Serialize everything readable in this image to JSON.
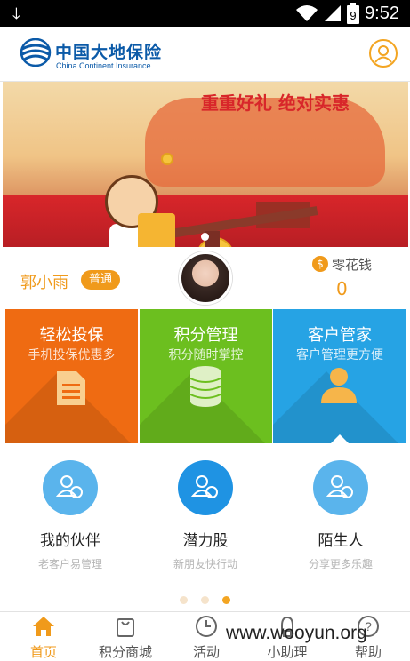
{
  "status_bar": {
    "time": "9:52",
    "battery_level": "9"
  },
  "header": {
    "brand_cn": "中国大地保险",
    "brand_en": "China Continent Insurance",
    "profile_icon": "user-circle-icon"
  },
  "banner": {
    "headline": "重重好礼 绝对实惠",
    "slide_count": 1,
    "active_slide": 1
  },
  "user": {
    "name": "郭小雨",
    "level": "普通",
    "wallet_label": "零花钱",
    "wallet_value": "0",
    "wallet_icon": "dollar-coin-icon"
  },
  "tiles": [
    {
      "title": "轻松投保",
      "subtitle": "手机投保优惠多",
      "icon": "document-icon",
      "color": "#ef6b12"
    },
    {
      "title": "积分管理",
      "subtitle": "积分随时掌控",
      "icon": "coin-stack-icon",
      "color": "#6cbf1f"
    },
    {
      "title": "客户管家",
      "subtitle": "客户管理更方便",
      "icon": "person-icon",
      "color": "#26a3e4"
    }
  ],
  "partners": [
    {
      "title": "我的伙伴",
      "subtitle": "老客户易管理",
      "icon": "partner-icon"
    },
    {
      "title": "潜力股",
      "subtitle": "新朋友快行动",
      "icon": "potential-icon"
    },
    {
      "title": "陌生人",
      "subtitle": "分享更多乐趣",
      "icon": "stranger-icon"
    }
  ],
  "pager": {
    "count": 3,
    "active": 3
  },
  "bottom_nav": [
    {
      "label": "首页",
      "icon": "home-icon",
      "active": true
    },
    {
      "label": "积分商城",
      "icon": "shopping-bag-icon",
      "active": false
    },
    {
      "label": "活动",
      "icon": "clock-icon",
      "active": false
    },
    {
      "label": "小助理",
      "icon": "assistant-icon",
      "active": false
    },
    {
      "label": "帮助",
      "icon": "help-icon",
      "active": false
    }
  ],
  "watermark": "www.wooyun.org",
  "colors": {
    "accent": "#f09a1b",
    "brand_blue": "#0b5aa8"
  }
}
